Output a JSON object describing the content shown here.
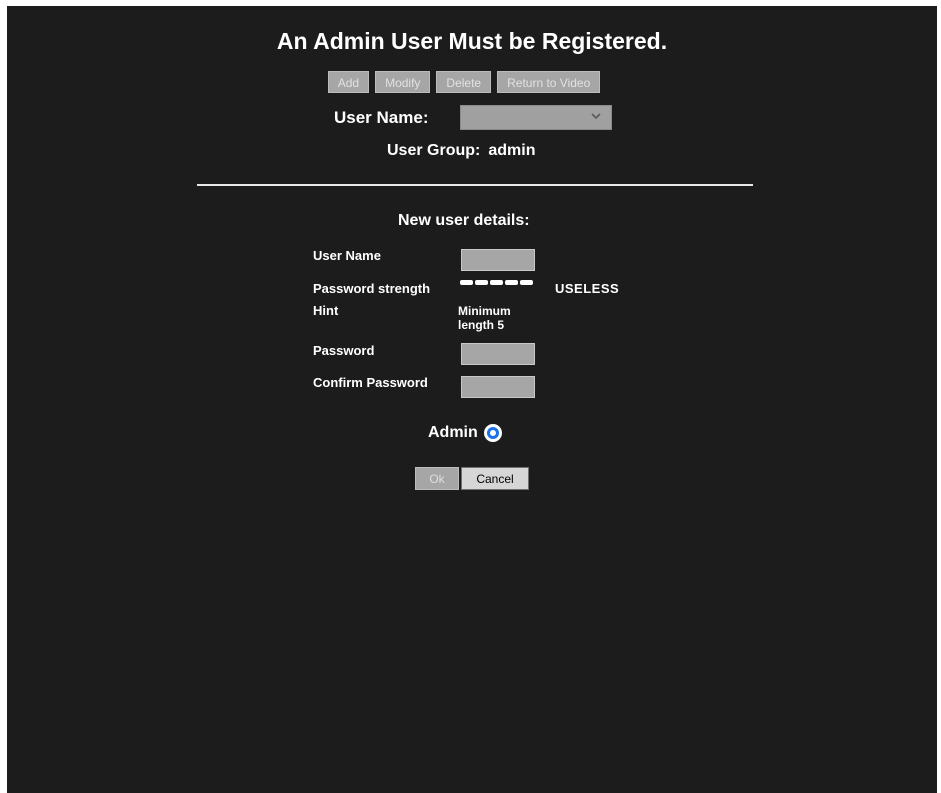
{
  "title": "An Admin User Must be Registered.",
  "toolbar": {
    "add": "Add",
    "modify": "Modify",
    "delete": "Delete",
    "return_to_video": "Return to Video"
  },
  "user_select": {
    "label": "User Name:",
    "selected": ""
  },
  "user_group": {
    "label": "User Group:",
    "value": "admin"
  },
  "new_user": {
    "heading": "New user details:",
    "username_label": "User Name",
    "username_value": "",
    "strength_label": "Password strength",
    "strength_value": "USELESS",
    "hint_label": "Hint",
    "hint_value": "Minimum length 5",
    "password_label": "Password",
    "password_value": "",
    "confirm_label": "Confirm Password",
    "confirm_value": "",
    "admin_label": "Admin",
    "admin_selected": true
  },
  "actions": {
    "ok": "Ok",
    "cancel": "Cancel"
  },
  "colors": {
    "background": "#1c1c1c",
    "text": "#ffffff",
    "disabled_button": "#a6a6a6",
    "radio_accent": "#1a73e8"
  }
}
